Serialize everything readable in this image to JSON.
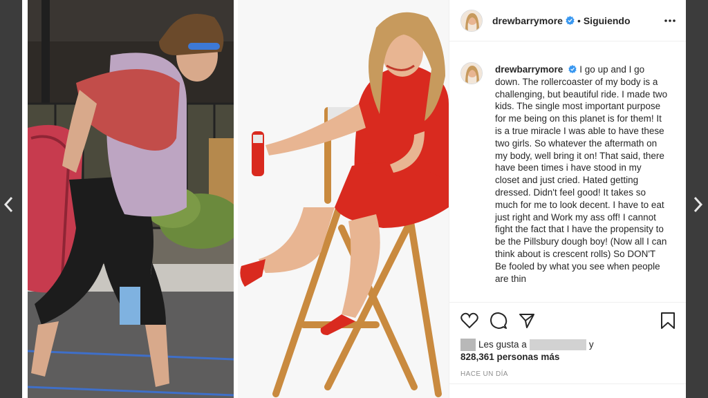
{
  "post": {
    "username": "drewbarrymore",
    "follow_status": "Siguiendo",
    "caption_username": "drewbarrymore",
    "caption_text": "I go up and I go down. The rollercoaster of my body is a challenging, but beautiful ride. I made two kids. The single most important purpose for me being on this planet is for them! It is a true miracle I was able to have these two girls. So whatever the aftermath on my body, well bring it on! That said, there have been times i have stood in my closet and just cried. Hated getting dressed. Didn't feel good! It takes so much for me to look decent. I have to eat just right and Work my ass off! I cannot fight the fact that I have the propensity to be the Pillsbury dough boy! (Now all I can think about is crescent rolls) So DON'T Be fooled by what you see when people are thin",
    "likes_prefix": "Les gusta a",
    "likes_conjunction": "y",
    "likes_count": "828,361 personas más",
    "timestamp": "HACE UN DÍA"
  },
  "icons": {
    "verified": "verified-badge-icon",
    "more": "more-options-icon",
    "like": "heart-icon",
    "comment": "comment-bubble-icon",
    "share": "paper-plane-icon",
    "save": "bookmark-icon",
    "prev": "chevron-left-icon",
    "next": "chevron-right-icon"
  },
  "colors": {
    "verified": "#3897f0",
    "dress": "#d92a1f",
    "text": "#262626",
    "muted": "#8e8e8e"
  }
}
